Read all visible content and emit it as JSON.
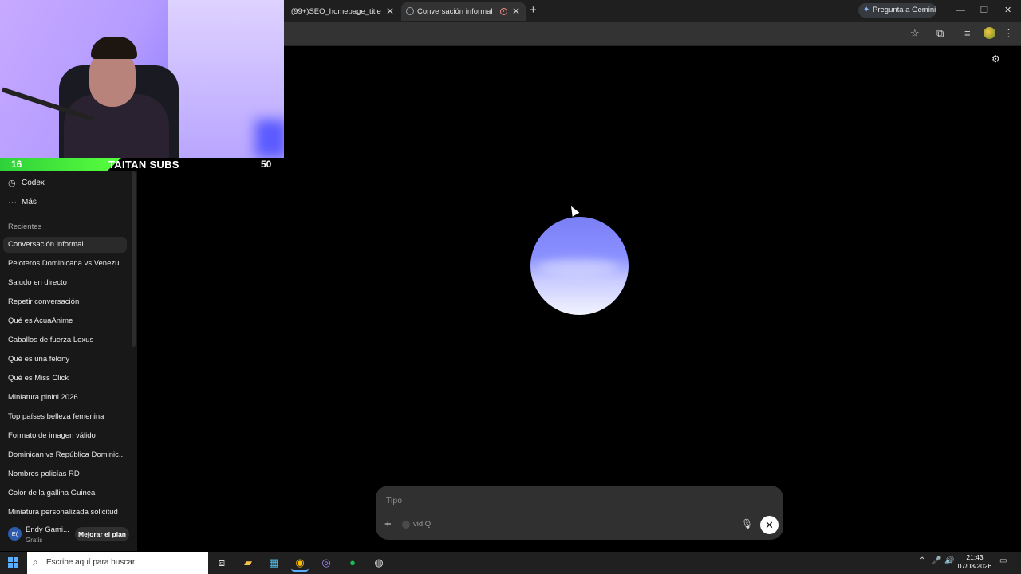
{
  "browser": {
    "tabs": [
      {
        "title": "(99+)SEO_homepage_title",
        "active": false
      },
      {
        "title": "Conversación informal",
        "active": true
      }
    ],
    "gemini_button": "Pregunta a Gemini"
  },
  "webcam": {
    "left_number": "16",
    "title": "TAITAN SUBS",
    "right_number": "50"
  },
  "sidebar": {
    "items": [
      {
        "label": "Codex",
        "icon": "clock-icon"
      },
      {
        "label": "Más",
        "icon": "more-icon"
      }
    ],
    "recents_heading": "Recientes",
    "recents": [
      "Conversación informal",
      "Peloteros Dominicana vs Venezu...",
      "Saludo en directo",
      "Repetir conversación",
      "Qué es AcuaAnime",
      "Caballos de fuerza Lexus",
      "Qué es una felony",
      "Qué es Miss Click",
      "Miniatura pinini 2026",
      "Top países belleza femenina",
      "Formato de imagen válido",
      "Dominican vs República Dominic...",
      "Nombres policías RD",
      "Color de la gallina Guinea",
      "Miniatura personalizada solicitud"
    ],
    "user": {
      "initials": "E(",
      "name": "Endy Gami...",
      "plan": "Gratis",
      "upgrade_label": "Mejorar el plan"
    }
  },
  "composer": {
    "placeholder": "Tipo",
    "extension": "vidIQ"
  },
  "taskbar": {
    "search_placeholder": "Escribe aquí para buscar.",
    "time": "21:43",
    "date": "07/08/2026"
  },
  "colors": {
    "orb_top": "#7a80f5",
    "orb_bottom": "#f3f4ff",
    "cam_bar_green": "#3cd83c"
  }
}
